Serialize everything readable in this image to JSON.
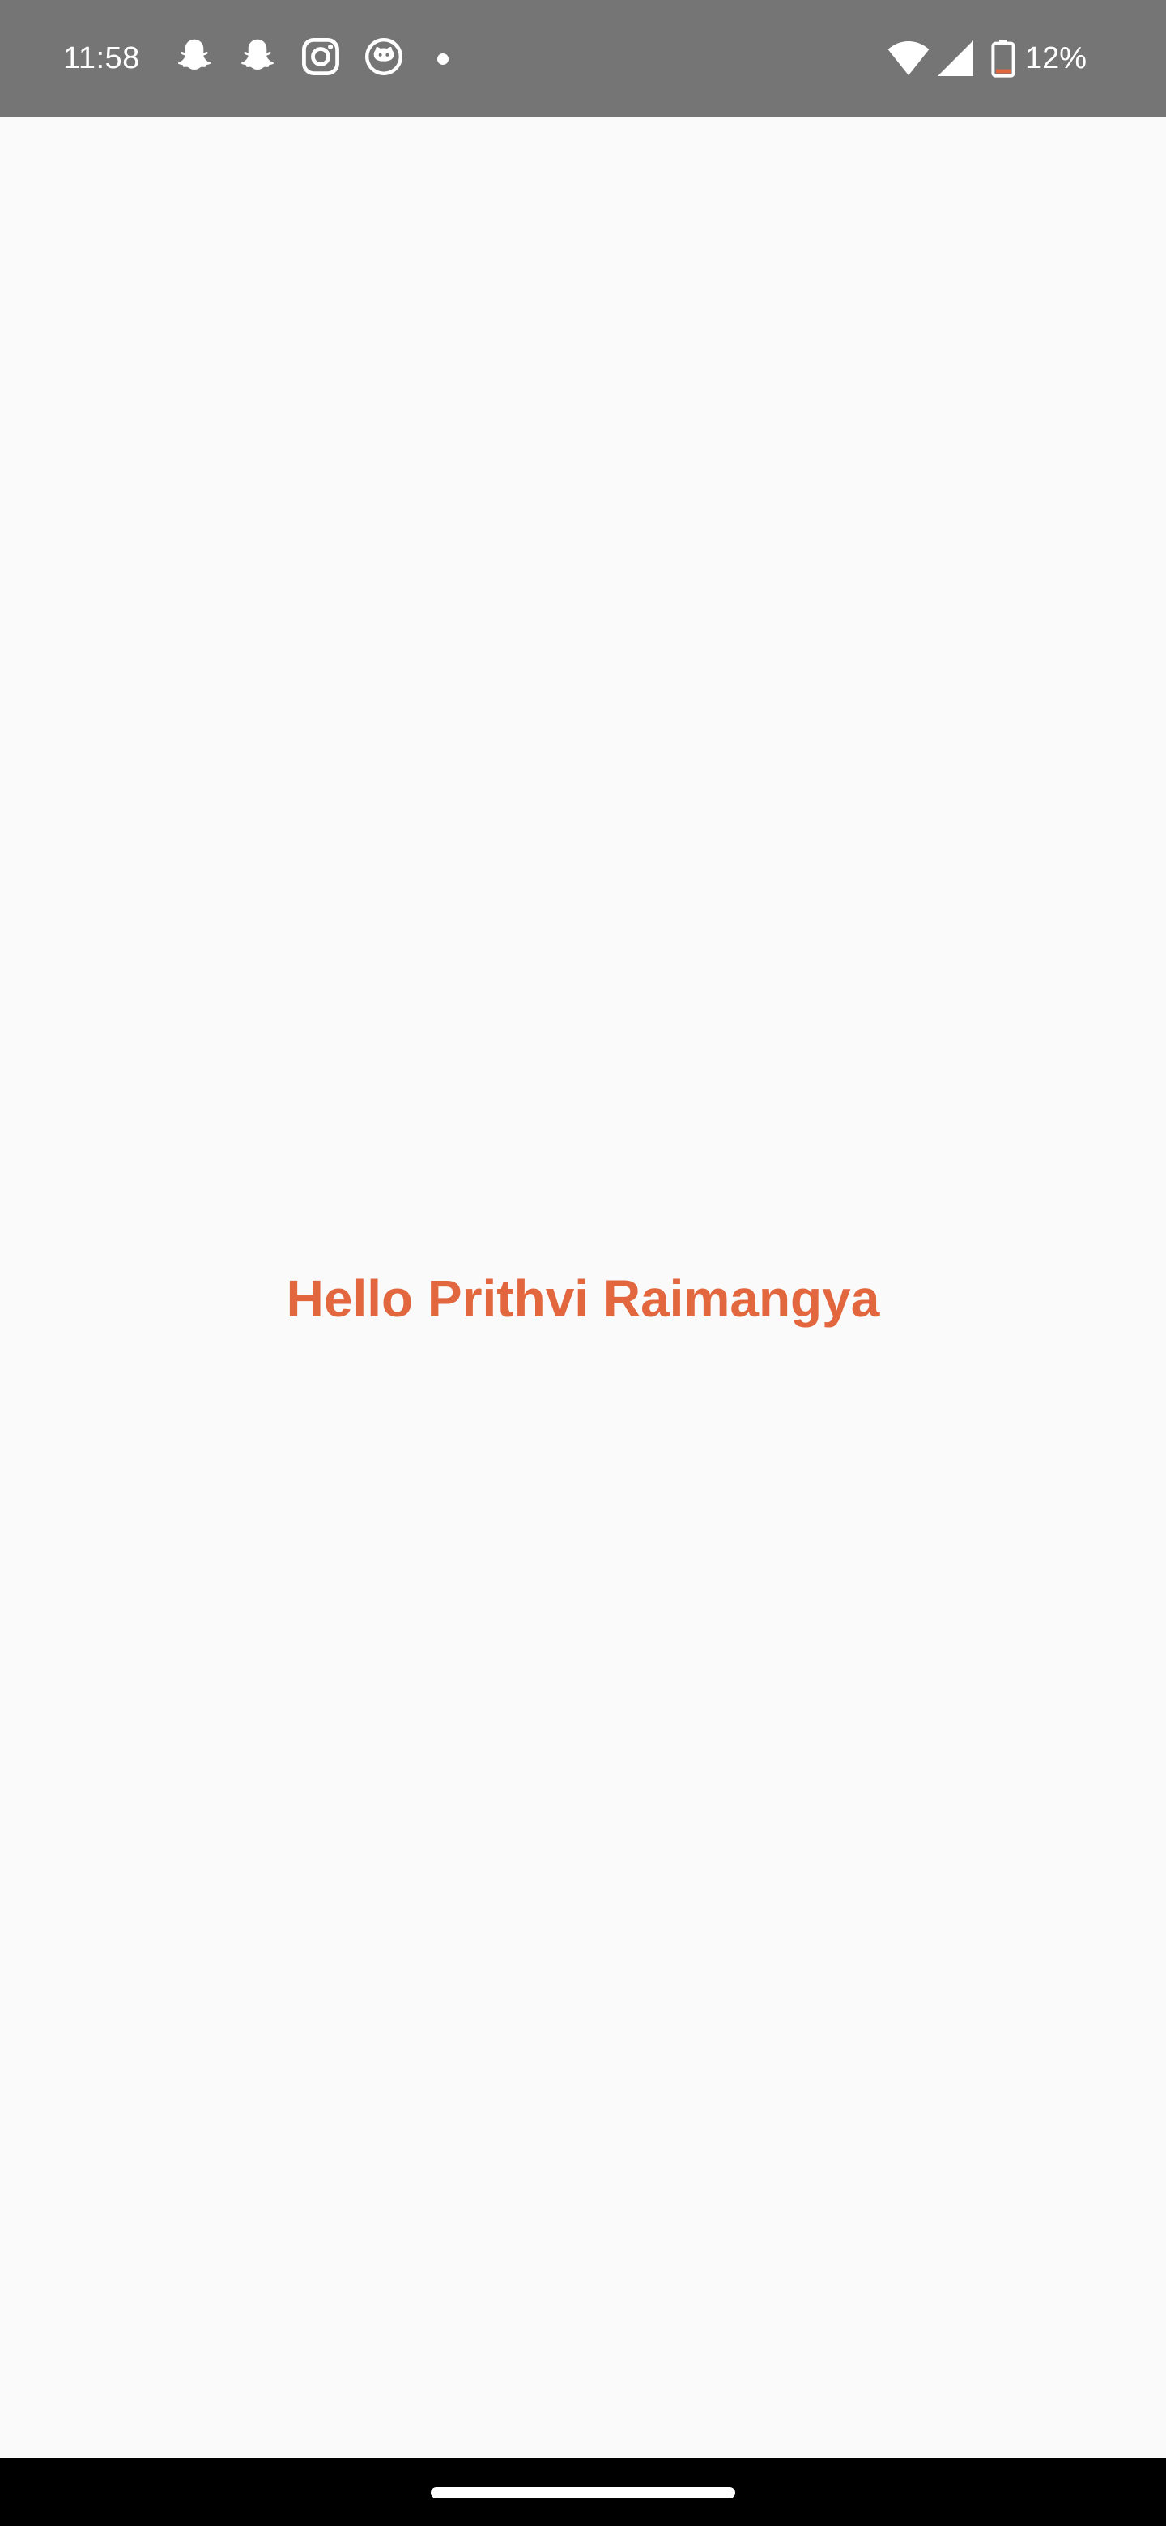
{
  "status_bar": {
    "time": "11:58",
    "notification_icons": [
      "snapchat-icon",
      "snapchat-icon",
      "instagram-icon",
      "github-icon",
      "more-notifications-dot"
    ],
    "battery_percent": "12%",
    "battery_level": 0.12,
    "colors": {
      "background": "#757575",
      "foreground": "#ffffff",
      "battery_low": "#e2673e"
    }
  },
  "main": {
    "greeting": "Hello Prithvi Raimangya",
    "colors": {
      "background": "#fafafa",
      "greeting_text": "#e2673e"
    }
  },
  "nav_bar": {
    "colors": {
      "background": "#000000",
      "home_indicator": "#ffffff"
    }
  }
}
